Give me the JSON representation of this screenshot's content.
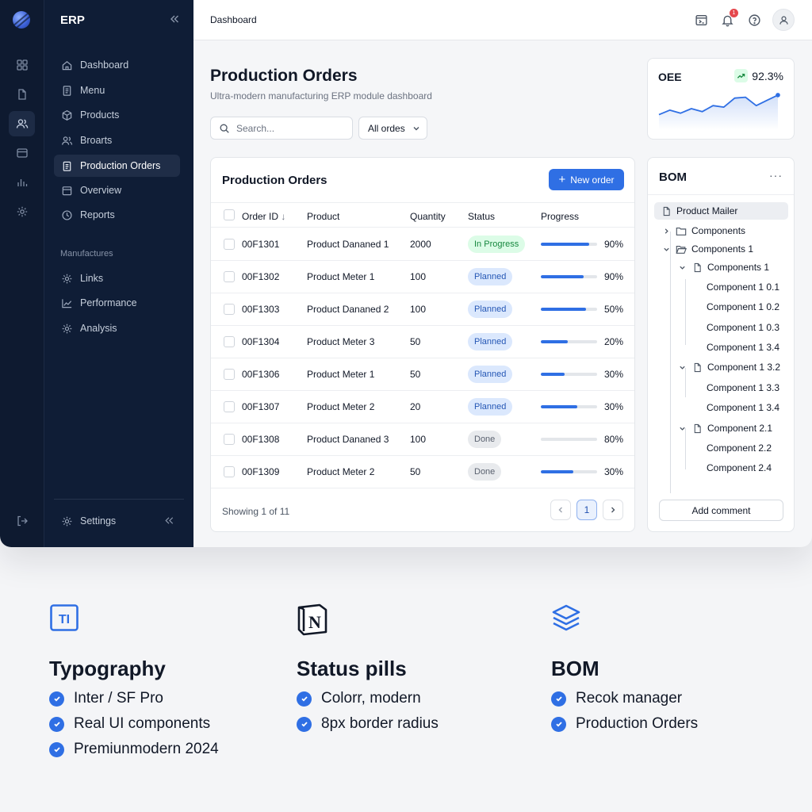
{
  "sidebar": {
    "brand": "ERP",
    "items": [
      {
        "label": "Dashboard",
        "icon": "home-icon"
      },
      {
        "label": "Menu",
        "icon": "file-icon"
      },
      {
        "label": "Products",
        "icon": "box-icon"
      },
      {
        "label": "Broarts",
        "icon": "users-icon"
      },
      {
        "label": "Production Orders",
        "icon": "clipboard-icon",
        "active": true
      },
      {
        "label": "Overview",
        "icon": "calendar-icon"
      },
      {
        "label": "Reports",
        "icon": "clock-icon"
      }
    ],
    "section_label": "Manufactures",
    "section_items": [
      {
        "label": "Links",
        "icon": "gear-icon"
      },
      {
        "label": "Performance",
        "icon": "chart-line-icon"
      },
      {
        "label": "Analysis",
        "icon": "gear-icon"
      }
    ],
    "settings_label": "Settings"
  },
  "topbar": {
    "breadcrumb": "Dashboard",
    "notification_count": "1"
  },
  "main": {
    "title": "Production Orders",
    "subtitle": "Ultra-modern manufacturing ERP module dashboard",
    "search_placeholder": "Search...",
    "filter_value": "All ordes"
  },
  "orders": {
    "title": "Production Orders",
    "new_button": "New order",
    "columns": [
      "Order ID",
      "Product",
      "Quantity",
      "Status",
      "Progress"
    ],
    "rows": [
      {
        "id": "00F1301",
        "product": "Product Dananed 1",
        "qty": "2000",
        "status": "In Progress",
        "status_kind": "inprogress",
        "pct_label": "90%",
        "bar": 0.86
      },
      {
        "id": "00F1302",
        "product": "Product Meter 1",
        "qty": "100",
        "status": "Planned",
        "status_kind": "planned",
        "pct_label": "90%",
        "bar": 0.76
      },
      {
        "id": "00F1303",
        "product": "Product Dananed 2",
        "qty": "100",
        "status": "Planned",
        "status_kind": "planned",
        "pct_label": "50%",
        "bar": 0.8
      },
      {
        "id": "00F1304",
        "product": "Product Meter 3",
        "qty": "50",
        "status": "Planned",
        "status_kind": "planned",
        "pct_label": "20%",
        "bar": 0.48
      },
      {
        "id": "00F1306",
        "product": "Product Meter 1",
        "qty": "50",
        "status": "Planned",
        "status_kind": "planned",
        "pct_label": "30%",
        "bar": 0.42
      },
      {
        "id": "00F1307",
        "product": "Product Meter 2",
        "qty": "20",
        "status": "Planned",
        "status_kind": "planned",
        "pct_label": "30%",
        "bar": 0.65
      },
      {
        "id": "00F1308",
        "product": "Product Dananed 3",
        "qty": "100",
        "status": "Done",
        "status_kind": "done",
        "pct_label": "80%",
        "bar": 0
      },
      {
        "id": "00F1309",
        "product": "Product Meter 2",
        "qty": "50",
        "status": "Done",
        "status_kind": "done",
        "pct_label": "30%",
        "bar": 0.58
      }
    ],
    "showing": "Showing 1 of 11",
    "page": "1"
  },
  "oee": {
    "label": "OEE",
    "value": "92.3%",
    "sparkline": [
      0.3,
      0.45,
      0.35,
      0.5,
      0.4,
      0.6,
      0.55,
      0.85,
      0.88,
      0.6,
      0.78,
      0.95
    ]
  },
  "bom": {
    "title": "BOM",
    "more": "···",
    "tree": [
      {
        "label": "Product Mailer",
        "icon": "doc",
        "level": 0,
        "selected": true
      },
      {
        "label": "Components",
        "icon": "folder",
        "level": 0,
        "chevron": "right"
      },
      {
        "label": "Components 1",
        "icon": "folder-open",
        "level": 0,
        "chevron": "down"
      },
      {
        "label": "Components 1",
        "icon": "doc",
        "level": 1,
        "chevron": "down"
      },
      {
        "label": "Component 1 0.1",
        "level": 2
      },
      {
        "label": "Component 1 0.2",
        "level": 2
      },
      {
        "label": "Component 1 0.3",
        "level": 2
      },
      {
        "label": "Component 1 3.4",
        "level": 2
      },
      {
        "label": "Component 1 3.2",
        "icon": "doc",
        "level": 1,
        "chevron": "down"
      },
      {
        "label": "Component 1 3.3",
        "level": 2
      },
      {
        "label": "Component 1 3.4",
        "level": 2
      },
      {
        "label": "Component 2.1",
        "icon": "doc",
        "level": 1,
        "chevron": "down"
      },
      {
        "label": "Component 2.2",
        "level": 2
      },
      {
        "label": "Component 2.4",
        "level": 2
      }
    ],
    "add_comment": "Add comment"
  },
  "features": [
    {
      "title": "Typography",
      "icon": "typography-icon",
      "items": [
        "Inter / SF Pro",
        "Real UI components",
        "Premiunmodern 2024"
      ]
    },
    {
      "title": "Status pills",
      "icon": "notion-icon",
      "items": [
        "Colorr, modern",
        "8px border radius"
      ]
    },
    {
      "title": "BOM",
      "icon": "layers-icon",
      "items": [
        "Recok manager",
        "Production Orders"
      ]
    }
  ],
  "colors": {
    "accent": "#2f6fe4",
    "sidebar_bg": "#0f1d36",
    "in_progress": "#16873e",
    "planned": "#2557b5",
    "done": "#5b6270"
  }
}
